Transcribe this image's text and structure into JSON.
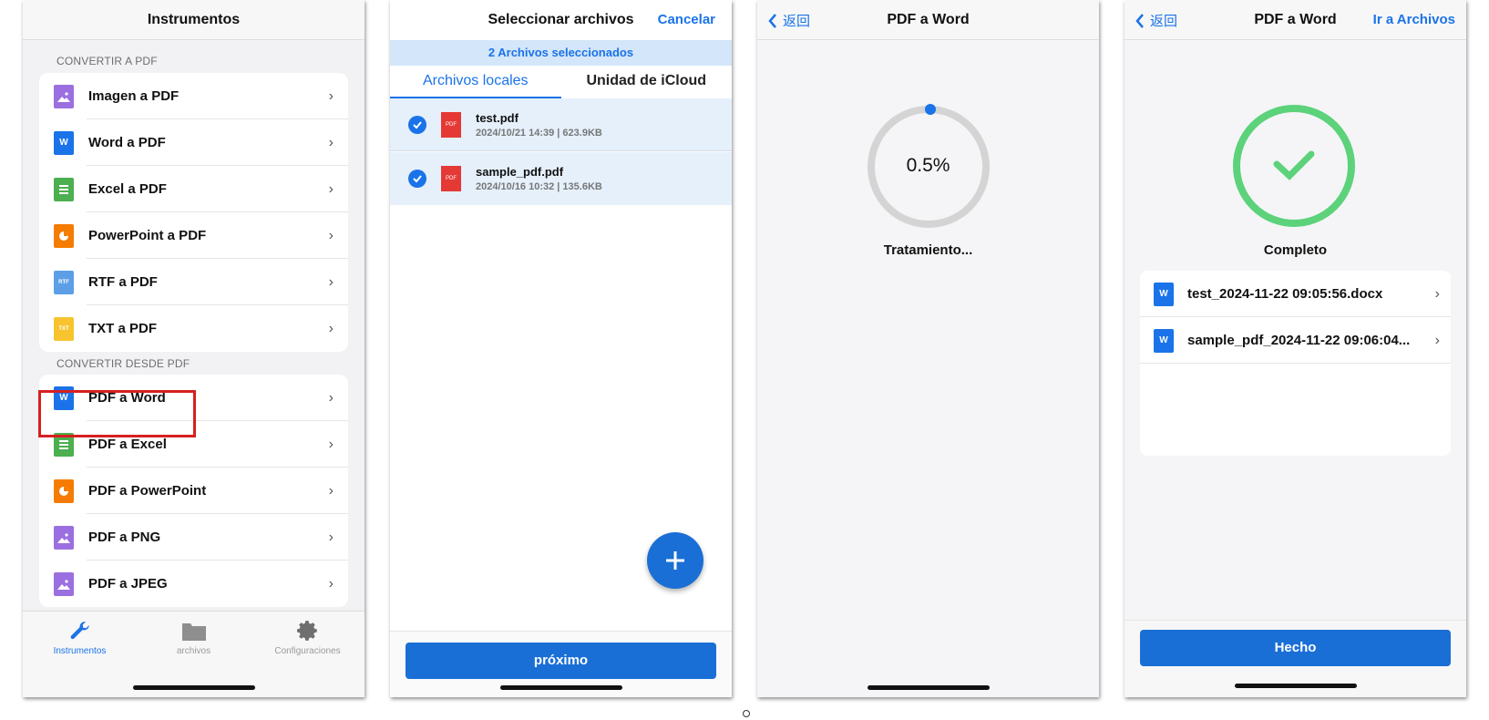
{
  "screen1": {
    "title": "Instrumentos",
    "section_to_pdf": "CONVERTIR A PDF",
    "to_pdf_items": [
      {
        "label": "Imagen a PDF",
        "icon": "image-icon",
        "color": "#9b6fe0",
        "glyph": ""
      },
      {
        "label": "Word a PDF",
        "icon": "word-icon",
        "color": "#1a73e8",
        "glyph": "W"
      },
      {
        "label": "Excel a PDF",
        "icon": "excel-icon",
        "color": "#4caf50",
        "glyph": ""
      },
      {
        "label": "PowerPoint a PDF",
        "icon": "powerpoint-icon",
        "color": "#f57c00",
        "glyph": ""
      },
      {
        "label": "RTF a PDF",
        "icon": "rtf-icon",
        "color": "#5c9fe6",
        "glyph": "RTF"
      },
      {
        "label": "TXT a PDF",
        "icon": "txt-icon",
        "color": "#f7c32e",
        "glyph": "TXT"
      }
    ],
    "section_from_pdf": "CONVERTIR DESDE PDF",
    "from_pdf_items": [
      {
        "label": "PDF a Word",
        "icon": "word-icon",
        "color": "#1a73e8",
        "glyph": "W"
      },
      {
        "label": "PDF a Excel",
        "icon": "excel-icon",
        "color": "#4caf50",
        "glyph": ""
      },
      {
        "label": "PDF a PowerPoint",
        "icon": "powerpoint-icon",
        "color": "#f57c00",
        "glyph": ""
      },
      {
        "label": "PDF a PNG",
        "icon": "image-icon",
        "color": "#9b6fe0",
        "glyph": ""
      },
      {
        "label": "PDF a JPEG",
        "icon": "image-icon",
        "color": "#9b6fe0",
        "glyph": ""
      }
    ],
    "tabs": {
      "tools": "Instrumentos",
      "files": "archivos",
      "settings": "Configuraciones"
    }
  },
  "screen2": {
    "title": "Seleccionar archivos",
    "cancel": "Cancelar",
    "selected_count": "2 Archivos seleccionados",
    "tab_local": "Archivos locales",
    "tab_icloud": "Unidad de iCloud",
    "files": [
      {
        "name": "test.pdf",
        "meta": "2024/10/21 14:39 | 623.9KB"
      },
      {
        "name": "sample_pdf.pdf",
        "meta": "2024/10/16 10:32 | 135.6KB"
      }
    ],
    "next_button": "próximo"
  },
  "screen3": {
    "back": "返回",
    "title": "PDF a Word",
    "progress_text": "0.5%",
    "progress_fraction": 0.005,
    "status": "Tratamiento..."
  },
  "screen4": {
    "back": "返回",
    "title": "PDF a Word",
    "go_files": "Ir a Archivos",
    "status": "Completo",
    "results": [
      "test_2024-11-22 09:05:56.docx",
      "sample_pdf_2024-11-22 09:06:04..."
    ],
    "done_button": "Hecho"
  },
  "colors": {
    "accent": "#1a73e8",
    "success": "#5cd27a",
    "highlight": "#d62020"
  }
}
